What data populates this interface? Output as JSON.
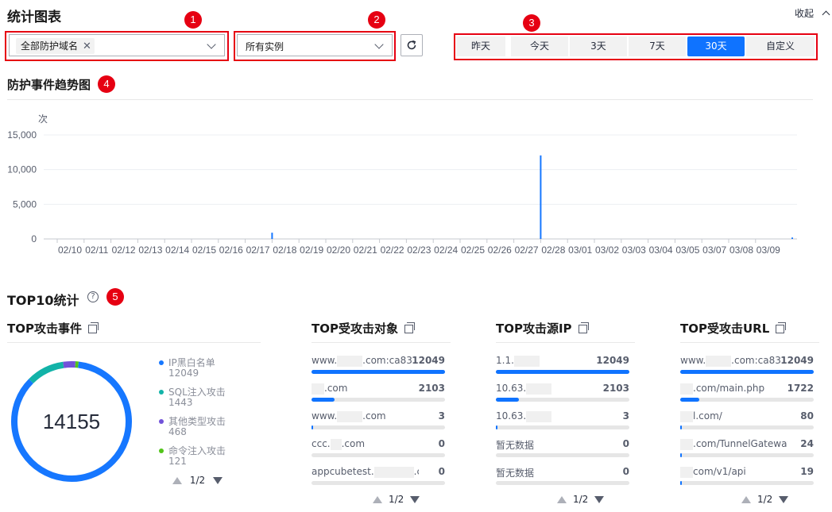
{
  "header": {
    "title": "统计图表",
    "collapse_label": "收起"
  },
  "filters": {
    "domain_tag": "全部防护域名",
    "instance_select": "所有实例",
    "time_ranges": [
      "昨天",
      "今天",
      "3天",
      "7天",
      "30天",
      "自定义"
    ],
    "active_range": "30天"
  },
  "badges": [
    "1",
    "2",
    "3",
    "4",
    "5"
  ],
  "trend": {
    "title": "防护事件趋势图",
    "chart_data": {
      "type": "bar",
      "ylabel": "次",
      "ylim": [
        0,
        15000
      ],
      "yticks": [
        "15,000",
        "10,000",
        "5,000",
        "0"
      ],
      "ytick_values": [
        15000,
        10000,
        5000,
        0
      ],
      "categories": [
        "02/10",
        "02/11",
        "02/12",
        "02/13",
        "02/14",
        "02/15",
        "02/16",
        "02/17",
        "02/18",
        "02/19",
        "02/20",
        "02/21",
        "02/22",
        "02/23",
        "02/24",
        "02/25",
        "02/26",
        "02/27",
        "02/28",
        "03/01",
        "03/02",
        "03/03",
        "03/04",
        "03/05",
        "03/07",
        "03/08",
        "03/09"
      ],
      "values": [
        0,
        0,
        0,
        0,
        0,
        0,
        0,
        0,
        900,
        0,
        0,
        0,
        0,
        0,
        0,
        0,
        0,
        0,
        12049,
        0,
        0,
        0,
        0,
        0,
        0,
        0,
        200
      ]
    }
  },
  "top10": {
    "title": "TOP10统计",
    "events": {
      "title": "TOP攻击事件",
      "total": "14155",
      "items": [
        {
          "name": "IP黑白名单",
          "value": "12049",
          "color": "#1677ff"
        },
        {
          "name": "SQL注入攻击",
          "value": "1443",
          "color": "#12b3a8"
        },
        {
          "name": "其他类型攻击",
          "value": "468",
          "color": "#7152d9"
        },
        {
          "name": "命令注入攻击",
          "value": "121",
          "color": "#52c41a"
        }
      ],
      "pager": "1/2"
    },
    "targets": {
      "title": "TOP受攻击对象",
      "rows": [
        {
          "name": "www.",
          "suffix": ".com:ca83…",
          "value": "12049",
          "pct": 1.0
        },
        {
          "name": "",
          "suffix": ".com",
          "value": "2103",
          "pct": 0.17
        },
        {
          "name": "www.",
          "suffix": ".com",
          "value": "3",
          "pct": 0.003
        },
        {
          "name": "ccc.",
          "suffix": ".com",
          "value": "0",
          "pct": 0
        },
        {
          "name": "appcubetest.",
          "suffix": ".com",
          "value": "0",
          "pct": 0
        }
      ],
      "pager": "1/2"
    },
    "source_ips": {
      "title": "TOP攻击源IP",
      "rows": [
        {
          "name": "1.1.",
          "value": "12049",
          "pct": 1.0
        },
        {
          "name": "10.63.",
          "value": "2103",
          "pct": 0.17
        },
        {
          "name": "10.63.",
          "value": "3",
          "pct": 0.003
        },
        {
          "name": "暂无数据",
          "value": "0",
          "pct": 0
        },
        {
          "name": "暂无数据",
          "value": "0",
          "pct": 0
        }
      ],
      "pager": "1/2"
    },
    "urls": {
      "title": "TOP受攻击URL",
      "rows": [
        {
          "name": "www.",
          "suffix": ".com:ca83…",
          "value": "12049",
          "pct": 1.0
        },
        {
          "name": "",
          "suffix": ".com/main.php",
          "value": "1722",
          "pct": 0.14
        },
        {
          "name": "",
          "suffix": "l.com/",
          "value": "80",
          "pct": 0.007
        },
        {
          "name": "",
          "suffix": ".com/TunnelGateway/co…",
          "value": "24",
          "pct": 0.002
        },
        {
          "name": "",
          "suffix": "com/v1/api",
          "value": "19",
          "pct": 0.002
        }
      ],
      "pager": "1/2"
    }
  }
}
